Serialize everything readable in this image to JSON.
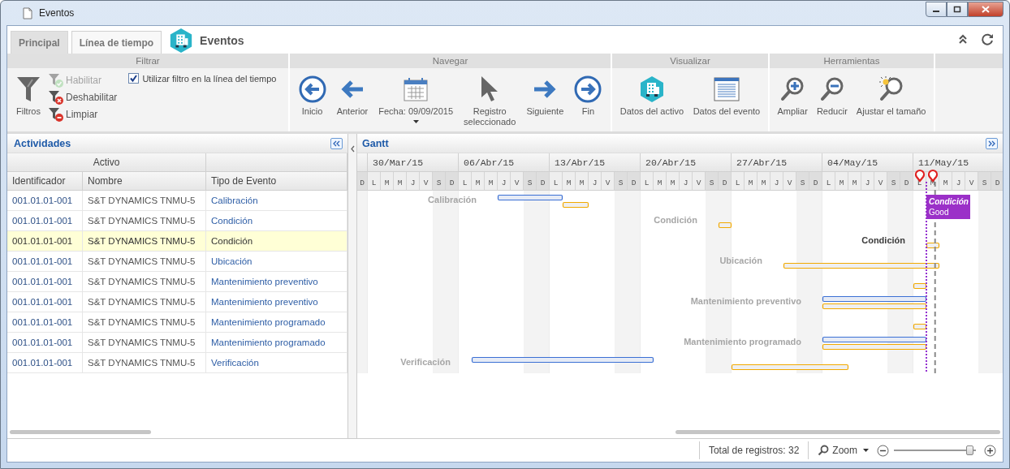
{
  "window": {
    "title": "Eventos"
  },
  "tabs": [
    {
      "label": "Principal",
      "selected": false
    },
    {
      "label": "Línea de tiempo",
      "selected": true
    }
  ],
  "header": {
    "title": "Eventos"
  },
  "ribbon": {
    "filter": {
      "title": "Filtrar",
      "button": "Filtros",
      "actions": [
        {
          "label": "Habilitar",
          "disabled": true
        },
        {
          "label": "Deshabilitar",
          "disabled": false
        },
        {
          "label": "Limpiar",
          "disabled": false
        }
      ],
      "checkbox": {
        "label": "Utilizar filtro en la línea del tiempo",
        "checked": true
      }
    },
    "groups": [
      {
        "title": "Navegar",
        "buttons": [
          {
            "label": "Inicio",
            "dropdown": false
          },
          {
            "label": "Anterior",
            "dropdown": false
          },
          {
            "label": "Fecha: 09/09/2015",
            "dropdown": true
          },
          {
            "label": "Registro\nseleccionado",
            "dropdown": false
          },
          {
            "label": "Siguiente",
            "dropdown": false
          },
          {
            "label": "Fin",
            "dropdown": false
          }
        ]
      },
      {
        "title": "Visualizar",
        "buttons": [
          {
            "label": "Datos del activo",
            "dropdown": false
          },
          {
            "label": "Datos del evento",
            "dropdown": false
          }
        ]
      },
      {
        "title": "Herramientas",
        "buttons": [
          {
            "label": "Ampliar",
            "dropdown": false
          },
          {
            "label": "Reducir",
            "dropdown": false
          },
          {
            "label": "Ajustar el tamaño",
            "dropdown": false
          }
        ]
      }
    ]
  },
  "activities": {
    "title": "Actividades",
    "group_header": "Activo",
    "columns": [
      "Identificador",
      "Nombre",
      "Tipo de Evento"
    ],
    "rows": [
      {
        "cells": [
          "001.01.01-001",
          "S&T DYNAMICS TNMU-5",
          "Calibración"
        ],
        "selected": false
      },
      {
        "cells": [
          "001.01.01-001",
          "S&T DYNAMICS TNMU-5",
          "Condición"
        ],
        "selected": false
      },
      {
        "cells": [
          "001.01.01-001",
          "S&T DYNAMICS TNMU-5",
          "Condición"
        ],
        "selected": true
      },
      {
        "cells": [
          "001.01.01-001",
          "S&T DYNAMICS TNMU-5",
          "Ubicación"
        ],
        "selected": false
      },
      {
        "cells": [
          "001.01.01-001",
          "S&T DYNAMICS TNMU-5",
          "Mantenimiento preventivo"
        ],
        "selected": false
      },
      {
        "cells": [
          "001.01.01-001",
          "S&T DYNAMICS TNMU-5",
          "Mantenimiento preventivo"
        ],
        "selected": false
      },
      {
        "cells": [
          "001.01.01-001",
          "S&T DYNAMICS TNMU-5",
          "Mantenimiento programado"
        ],
        "selected": false
      },
      {
        "cells": [
          "001.01.01-001",
          "S&T DYNAMICS TNMU-5",
          "Mantenimiento programado"
        ],
        "selected": false
      },
      {
        "cells": [
          "001.01.01-001",
          "S&T DYNAMICS TNMU-5",
          "Verificación"
        ],
        "selected": false
      }
    ]
  },
  "gantt": {
    "title": "Gantt",
    "weeks": [
      "30/Mar/15",
      "06/Abr/15",
      "13/Abr/15",
      "20/Abr/15",
      "27/Abr/15",
      "04/May/15",
      "11/May/15"
    ],
    "days": [
      "D",
      "L",
      "M",
      "M",
      "J",
      "V",
      "S",
      "D",
      "L",
      "M",
      "M",
      "J",
      "V",
      "S",
      "D",
      "L",
      "M",
      "M",
      "J",
      "V",
      "S",
      "D",
      "L",
      "M",
      "M",
      "J",
      "V",
      "S",
      "D",
      "L",
      "M",
      "M",
      "J",
      "V",
      "S",
      "D",
      "L",
      "M",
      "M",
      "J",
      "V",
      "S",
      "D",
      "L",
      "M",
      "M",
      "J",
      "V",
      "S",
      "D"
    ],
    "labels": [
      "Calibración",
      "Condición",
      "Condición",
      "Ubicación",
      "Mantenimiento preventivo",
      "Mantenimiento programado",
      "Verificación"
    ],
    "tooltip": {
      "title": "Condición",
      "text": "Good"
    }
  },
  "status": {
    "total": "Total de registros: 32",
    "zoom": {
      "label": "Zoom",
      "level": 0.92
    }
  }
}
